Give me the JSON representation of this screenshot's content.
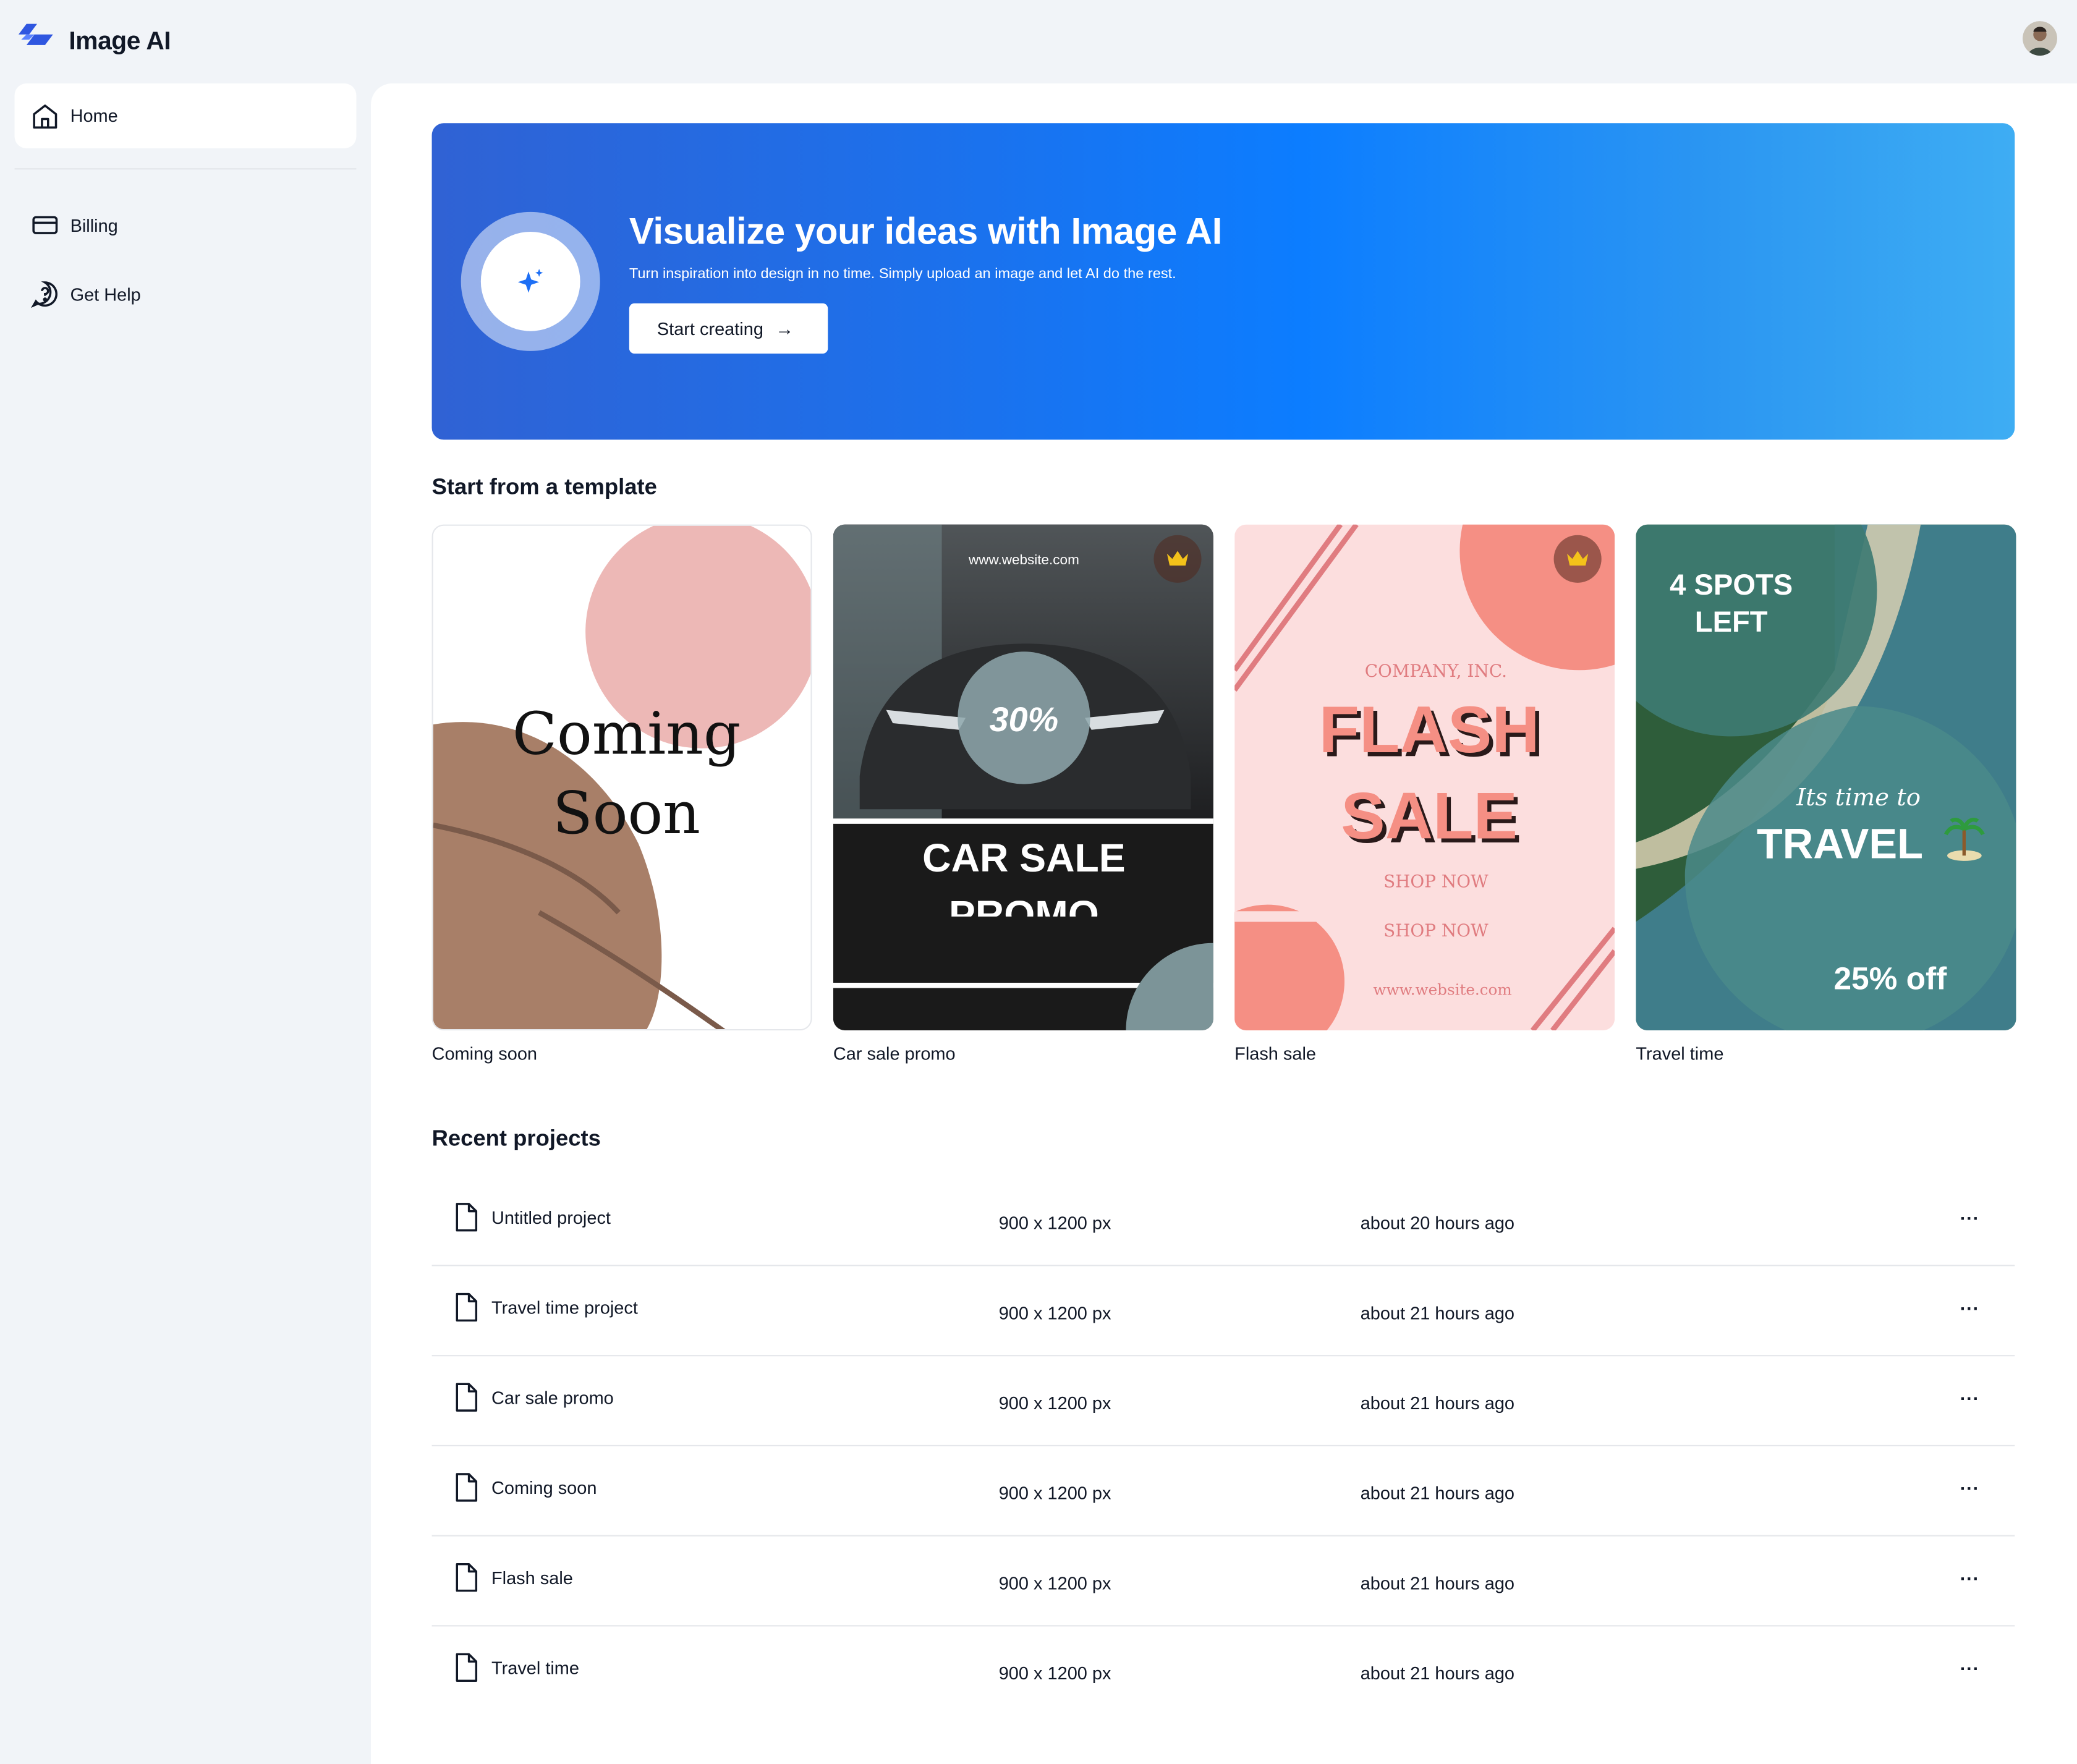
{
  "app": {
    "title": "Image AI"
  },
  "colors": {
    "accent": "#0c7dff",
    "hero_start": "#3062d4",
    "hero_end": "#3eadf3"
  },
  "sidebar": {
    "items": [
      {
        "label": "Home",
        "icon": "home-icon",
        "active": true
      },
      {
        "label": "Billing",
        "icon": "credit-card-icon"
      },
      {
        "label": "Get Help",
        "icon": "help-bubble-icon"
      }
    ]
  },
  "hero": {
    "title": "Visualize your ideas with Image AI",
    "subtitle": "Turn inspiration into design in no time. Simply upload an image and let AI do the rest.",
    "button_label": "Start creating",
    "icon": "sparkles-icon"
  },
  "templates": {
    "title": "Start from a template",
    "items": [
      {
        "label": "Coming soon",
        "art": {
          "line1": "Coming",
          "line2": "Soon"
        }
      },
      {
        "label": "Car sale promo",
        "premium": true,
        "art": {
          "url": "www.website.com",
          "discount": "30%",
          "headline": "CAR SALE",
          "sub": "PROMO"
        }
      },
      {
        "label": "Flash sale",
        "premium": true,
        "art": {
          "company": "COMPANY, INC.",
          "line1": "FLASH",
          "line2": "SALE",
          "cta": "SHOP NOW",
          "url": "www.website.com"
        }
      },
      {
        "label": "Travel time",
        "art": {
          "spots": "4 SPOTS LEFT",
          "script": "Its time to",
          "headline": "TRAVEL",
          "discount": "25% off"
        }
      }
    ]
  },
  "projects": {
    "title": "Recent projects",
    "rows": [
      {
        "name": "Untitled project",
        "size": "900 x 1200 px",
        "updated": "about 20 hours ago"
      },
      {
        "name": "Travel time project",
        "size": "900 x 1200 px",
        "updated": "about 21 hours ago"
      },
      {
        "name": "Car sale promo",
        "size": "900 x 1200 px",
        "updated": "about 21 hours ago"
      },
      {
        "name": "Coming soon",
        "size": "900 x 1200 px",
        "updated": "about 21 hours ago"
      },
      {
        "name": "Flash sale",
        "size": "900 x 1200 px",
        "updated": "about 21 hours ago"
      },
      {
        "name": "Travel time",
        "size": "900 x 1200 px",
        "updated": "about 21 hours ago"
      }
    ],
    "more_label": "..."
  }
}
